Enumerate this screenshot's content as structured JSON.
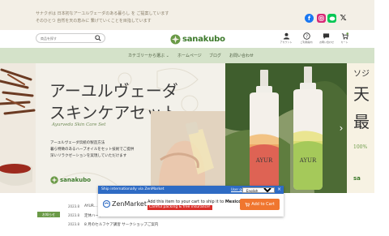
{
  "topbar": {
    "message_line1": "サナクボは 日本初なアーユルヴェーダのある暮らし を ご提案しています",
    "message_line2": "そのひとつ 自然を天の恵みに 繋げていくことを目指しています",
    "social_icons": [
      "facebook-icon",
      "instagram-icon",
      "line-icon",
      "x-icon"
    ]
  },
  "header": {
    "search_placeholder": "商品を探す",
    "logo_text": "sanakubo",
    "icons": [
      {
        "name": "account-icon",
        "label": "アカウント"
      },
      {
        "name": "help-icon",
        "label": "ご利用案内"
      },
      {
        "name": "chat-icon",
        "label": "お問い合わせ"
      },
      {
        "name": "cart-icon",
        "label": "カート"
      }
    ]
  },
  "nav": {
    "items": [
      "カテゴリーから選ぶ ⌄",
      "ホームページ",
      "ブログ",
      "お問い合わせ"
    ]
  },
  "banner": {
    "title_line1": "アーユルヴェーダ",
    "title_line2": "スキンケアセット",
    "subtitle": "Ayurveda Skin Care Set",
    "desc_line1": "アーユルヴェーダ伝統の製造方法",
    "desc_line2": "暮ら特徴のあるハーブオイルをセット技術でご提供",
    "desc_line3": "深いリラクゼーションを実現していただけます",
    "logo_text": "sanakubo",
    "bottle_label": "AYUR",
    "right_peek_chars": [
      "ソジ",
      "天",
      "最",
      "100%"
    ],
    "right_peek_logo": "sa",
    "colors": {
      "accent_green": "#3d7a2c",
      "nav_green": "#d4e2c9"
    }
  },
  "news": {
    "badge": "お知らせ",
    "items": [
      {
        "date": "2023.8",
        "title": "AYUR..."
      },
      {
        "date": "2023.8",
        "title": "定休ハーブ..."
      },
      {
        "date": "2023.8",
        "title": "8 月のセルフケア講習 サークショップご案内"
      }
    ]
  },
  "zenmarket": {
    "bar_title": "Ship internationally via ZenMarket",
    "user_guide": "User guide",
    "language": "English",
    "language_options": [
      "English"
    ],
    "close": "×",
    "logo_text": "ZenMarket",
    "message_prefix": "Add this item to your cart to ship it to",
    "country": "Mexico",
    "tagline": "Careful packing & free insurance!",
    "button_label": "Add to Cart",
    "colors": {
      "bar": "#2e6bc4",
      "button": "#f0762f",
      "tagline": "#d9302b"
    }
  }
}
